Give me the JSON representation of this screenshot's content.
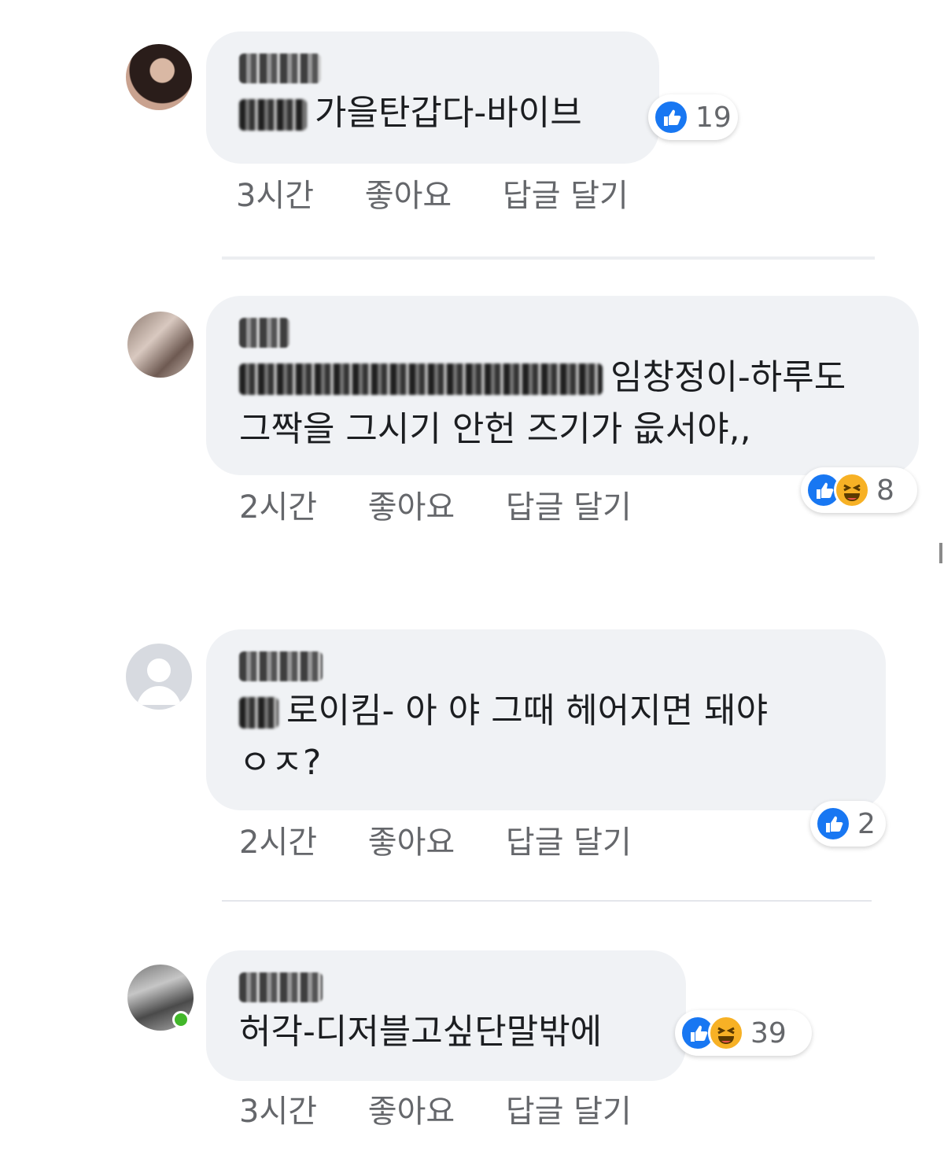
{
  "comments": [
    {
      "text": "가을탄갑다-바이브",
      "time": "3시간",
      "like": "좋아요",
      "reply": "답글 달기",
      "reactions": [
        "like"
      ],
      "count": "19"
    },
    {
      "text_line1": "임창정이-하루도",
      "text_line2": "그짝을 그시기 안헌 즈기가 읎서야,,",
      "time": "2시간",
      "like": "좋아요",
      "reply": "답글 달기",
      "reactions": [
        "like",
        "haha"
      ],
      "count": "8"
    },
    {
      "text_line1": "로이킴- 아 야 그때 헤어지면 돼야",
      "text_line2": "ㅇㅈ?",
      "time": "2시간",
      "like": "좋아요",
      "reply": "답글 달기",
      "reactions": [
        "like"
      ],
      "count": "2"
    },
    {
      "text": "허각-디저블고싶단말밖에",
      "time": "3시간",
      "like": "좋아요",
      "reply": "답글 달기",
      "reactions": [
        "like",
        "haha"
      ],
      "count": "39"
    }
  ],
  "colors": {
    "bubble": "#f0f2f5",
    "like_blue": "#1877f2",
    "haha_yellow": "#f7b125",
    "meta_gray": "#65676b",
    "online_green": "#42b72a"
  }
}
